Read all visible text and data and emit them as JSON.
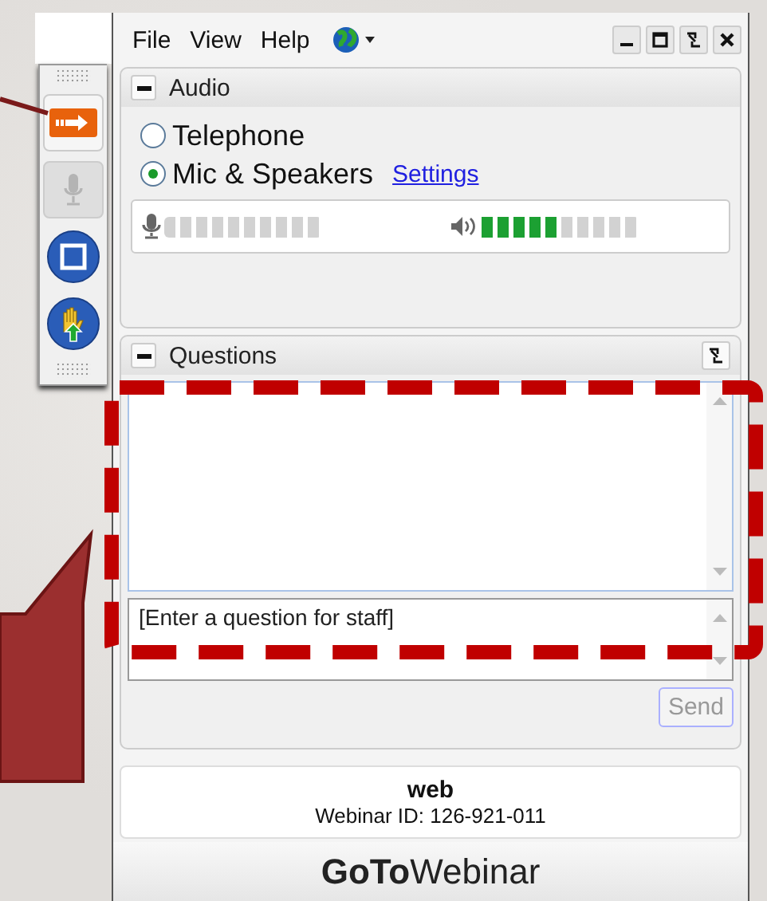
{
  "menu": [
    "File",
    "View",
    "Help"
  ],
  "toolbar": [
    {
      "kind": "show_hide",
      "disabled": false
    },
    {
      "kind": "mic",
      "disabled": true
    },
    {
      "kind": "screen",
      "disabled": false
    },
    {
      "kind": "raise_hand",
      "disabled": false
    }
  ],
  "audio": {
    "title": "Audio",
    "expanded": true,
    "options": [
      {
        "label": "Telephone",
        "selected": false
      },
      {
        "label": "Mic & Speakers",
        "selected": true
      }
    ],
    "settings_link": "Settings",
    "mic_meter": {
      "level": 0
    },
    "speaker_meter": {
      "level": 0.5
    }
  },
  "questions": {
    "title": "Questions",
    "expanded": true,
    "input": {
      "placeholder": "[Enter a question for staff]"
    },
    "send_button": {
      "label": "Send",
      "disabled": true
    }
  },
  "info": {
    "title": "web",
    "webinar_id": "Webinar ID: 126-921-011"
  },
  "brand": "**GoTo**Webinar"
}
